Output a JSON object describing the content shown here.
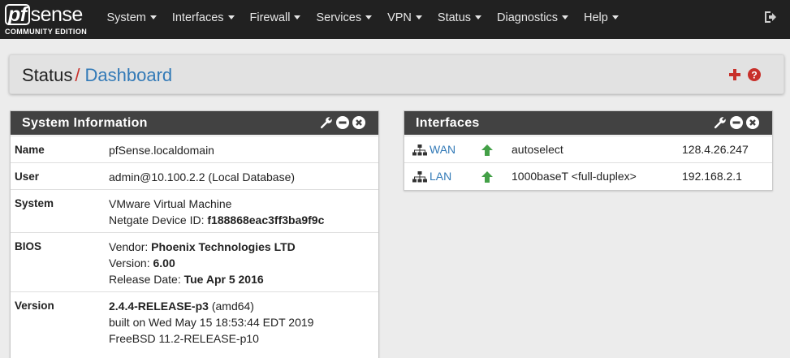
{
  "brand": {
    "logo_pf": "pf",
    "logo_sense": "sense",
    "edition": "COMMUNITY EDITION"
  },
  "nav": {
    "items": [
      {
        "label": "System"
      },
      {
        "label": "Interfaces"
      },
      {
        "label": "Firewall"
      },
      {
        "label": "Services"
      },
      {
        "label": "VPN"
      },
      {
        "label": "Status"
      },
      {
        "label": "Diagnostics"
      },
      {
        "label": "Help"
      }
    ]
  },
  "breadcrumb": {
    "parent": "Status",
    "separator": "/",
    "current": "Dashboard"
  },
  "system_info": {
    "title": "System Information",
    "rows": {
      "name": {
        "label": "Name",
        "value": "pfSense.localdomain"
      },
      "user": {
        "label": "User",
        "value": "admin@10.100.2.2 (Local Database)"
      },
      "system": {
        "label": "System",
        "line1": "VMware Virtual Machine",
        "line2_prefix": "Netgate Device ID:",
        "line2_value": "f188868eac3ff3ba9f9c"
      },
      "bios": {
        "label": "BIOS",
        "vendor_prefix": "Vendor:",
        "vendor": "Phoenix Technologies LTD",
        "version_prefix": "Version:",
        "version": "6.00",
        "release_prefix": "Release Date:",
        "release": "Tue Apr 5 2016"
      },
      "version": {
        "label": "Version",
        "release": "2.4.4-RELEASE-p3",
        "arch": "(amd64)",
        "built": "built on Wed May 15 18:53:44 EDT 2019",
        "freebsd": "FreeBSD 11.2-RELEASE-p10"
      }
    }
  },
  "interfaces": {
    "title": "Interfaces",
    "rows": [
      {
        "name": "WAN",
        "media": "autoselect",
        "ip": "128.4.26.247",
        "status": "up"
      },
      {
        "name": "LAN",
        "media": "1000baseT <full-duplex>",
        "ip": "192.168.2.1",
        "status": "up"
      }
    ]
  },
  "colors": {
    "navbar": "#212121",
    "panel_header": "#424242",
    "link": "#337ab7",
    "accent_red": "#c8302a",
    "status_up": "#43a047"
  },
  "icons": [
    "logout-icon",
    "plus-icon",
    "help-icon",
    "wrench-icon",
    "minimize-icon",
    "close-icon",
    "network-icon",
    "arrow-up-icon"
  ]
}
